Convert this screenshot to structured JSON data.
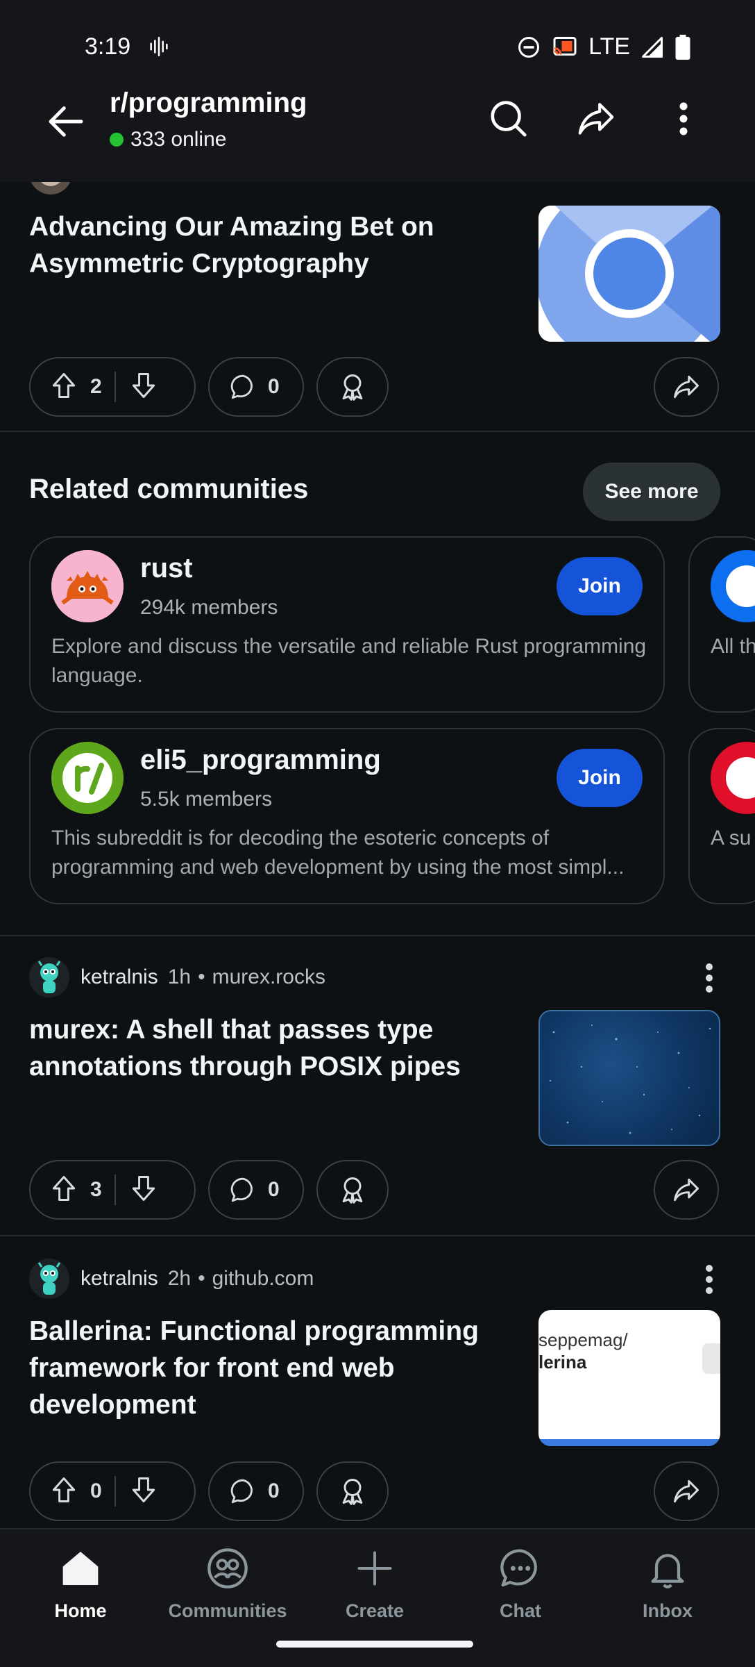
{
  "status_bar": {
    "time": "3:19",
    "network": "LTE"
  },
  "header": {
    "title": "r/programming",
    "online": "333 online"
  },
  "posts": [
    {
      "title": "Advancing Our Amazing Bet on Asymmetric Cryptography",
      "upvotes": "2",
      "comments": "0"
    },
    {
      "user": "ketralnis",
      "time": "1h",
      "domain": "murex.rocks",
      "title": "murex: A shell that passes type annotations through POSIX pipes",
      "upvotes": "3",
      "comments": "0"
    },
    {
      "user": "ketralnis",
      "time": "2h",
      "domain": "github.com",
      "title": "Ballerina: Functional programming framework for front end web development",
      "upvotes": "0",
      "comments": "0",
      "thumb_text_1": "seppemag/",
      "thumb_text_2": "lerina"
    }
  ],
  "related": {
    "title": "Related communities",
    "see_more": "See more",
    "communities": [
      {
        "name": "rust",
        "members": "294k members",
        "description": "Explore and discuss the versatile and reliable Rust programming language.",
        "join": "Join"
      },
      {
        "name": "eli5_programming",
        "members": "5.5k members",
        "description": "This subreddit is for decoding the esoteric concepts of programming and web development by using the most simpl...",
        "join": "Join"
      }
    ],
    "peek": [
      {
        "text": "All th"
      },
      {
        "text": "A su behi"
      }
    ]
  },
  "bottom_nav": {
    "items": [
      {
        "label": "Home",
        "icon": "home-icon"
      },
      {
        "label": "Communities",
        "icon": "communities-icon"
      },
      {
        "label": "Create",
        "icon": "plus-icon"
      },
      {
        "label": "Chat",
        "icon": "chat-icon"
      },
      {
        "label": "Inbox",
        "icon": "bell-icon"
      }
    ]
  },
  "colors": {
    "background": "#0e1113",
    "join_button": "#1553d8",
    "online_dot": "#23c233"
  }
}
